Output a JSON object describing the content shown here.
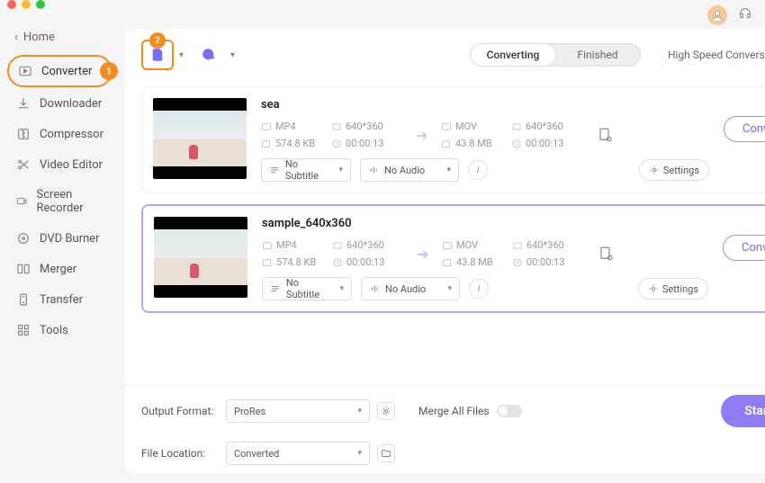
{
  "header": {
    "back_label": "Home"
  },
  "sidebar": {
    "active_badge": "1",
    "items": [
      {
        "id": "converter",
        "label": "Converter",
        "active": true
      },
      {
        "id": "downloader",
        "label": "Downloader"
      },
      {
        "id": "compressor",
        "label": "Compressor"
      },
      {
        "id": "video-editor",
        "label": "Video Editor"
      },
      {
        "id": "screen-recorder",
        "label": "Screen Recorder"
      },
      {
        "id": "dvd-burner",
        "label": "DVD Burner"
      },
      {
        "id": "merger",
        "label": "Merger"
      },
      {
        "id": "transfer",
        "label": "Transfer"
      },
      {
        "id": "tools",
        "label": "Tools"
      }
    ]
  },
  "toolbar": {
    "add_file_badge": "2",
    "tabs": {
      "converting": "Converting",
      "finished": "Finished"
    },
    "high_speed_label": "High Speed Conversion"
  },
  "items": [
    {
      "title": "sea",
      "src": {
        "format": "MP4",
        "resolution": "640*360",
        "size": "574.8 KB",
        "duration": "00:00:13"
      },
      "dst": {
        "format": "MOV",
        "resolution": "640*360",
        "size": "43.8 MB",
        "duration": "00:00:13"
      },
      "subtitle": "No Subtitle",
      "audio": "No Audio",
      "convert_label": "Convert",
      "settings_label": "Settings",
      "selected": false
    },
    {
      "title": "sample_640x360",
      "src": {
        "format": "MP4",
        "resolution": "640*360",
        "size": "574.8 KB",
        "duration": "00:00:13"
      },
      "dst": {
        "format": "MOV",
        "resolution": "640*360",
        "size": "43.8 MB",
        "duration": "00:00:13"
      },
      "subtitle": "No Subtitle",
      "audio": "No Audio",
      "convert_label": "Convert",
      "settings_label": "Settings",
      "selected": true
    }
  ],
  "footer": {
    "output_format_label": "Output Format:",
    "output_format_value": "ProRes",
    "file_location_label": "File Location:",
    "file_location_value": "Converted",
    "merge_label": "Merge All Files",
    "start_label": "Start All"
  }
}
